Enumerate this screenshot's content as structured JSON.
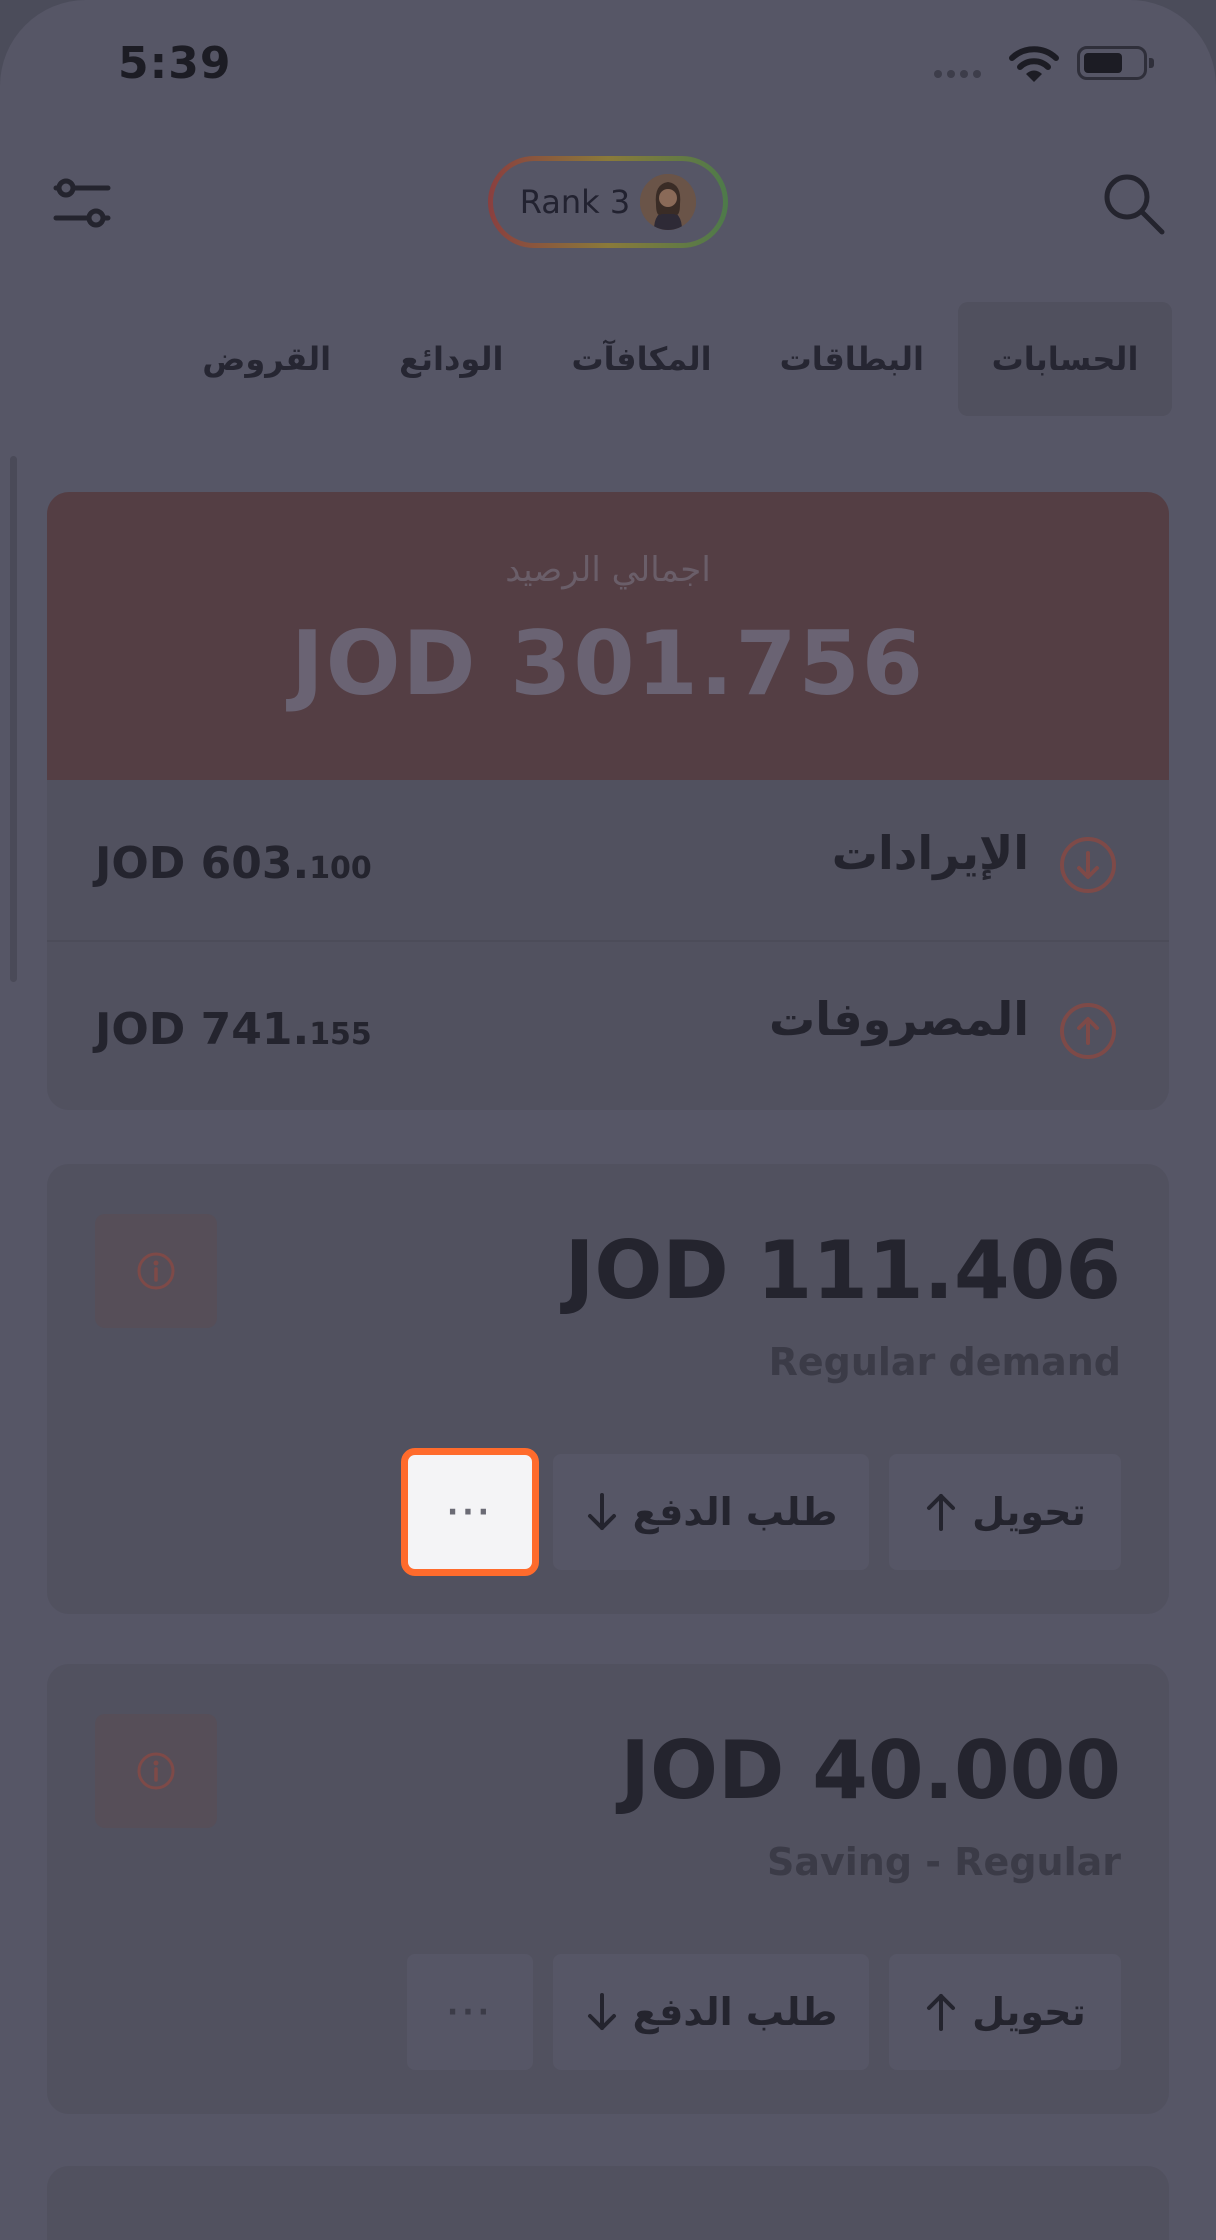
{
  "status_bar": {
    "time": "5:39"
  },
  "header": {
    "rank_label": "Rank 3"
  },
  "tabs": [
    "الحسابات",
    "البطاقات",
    "المكافآت",
    "الودائع",
    "القروض"
  ],
  "balance": {
    "label": "اجمالي الرصيد",
    "value": "JOD 301.756"
  },
  "summary": {
    "income": {
      "label": "الإيرادات",
      "amount_main": "JOD 603.",
      "amount_decimal": "100"
    },
    "expenses": {
      "label": "المصروفات",
      "amount_main": "JOD 741.",
      "amount_decimal": "155"
    }
  },
  "accounts": [
    {
      "amount": "JOD 111.406",
      "type": "Regular demand",
      "transfer_label": "تحويل",
      "request_label": "طلب الدفع",
      "more_label": "···"
    },
    {
      "amount": "JOD 40.000",
      "type": "Saving - Regular",
      "transfer_label": "تحويل",
      "request_label": "طلب الدفع",
      "more_label": "···"
    }
  ],
  "colors": {
    "accent": "#ff6b2c",
    "overlay": "#565666",
    "balance_card": "#543e44"
  }
}
